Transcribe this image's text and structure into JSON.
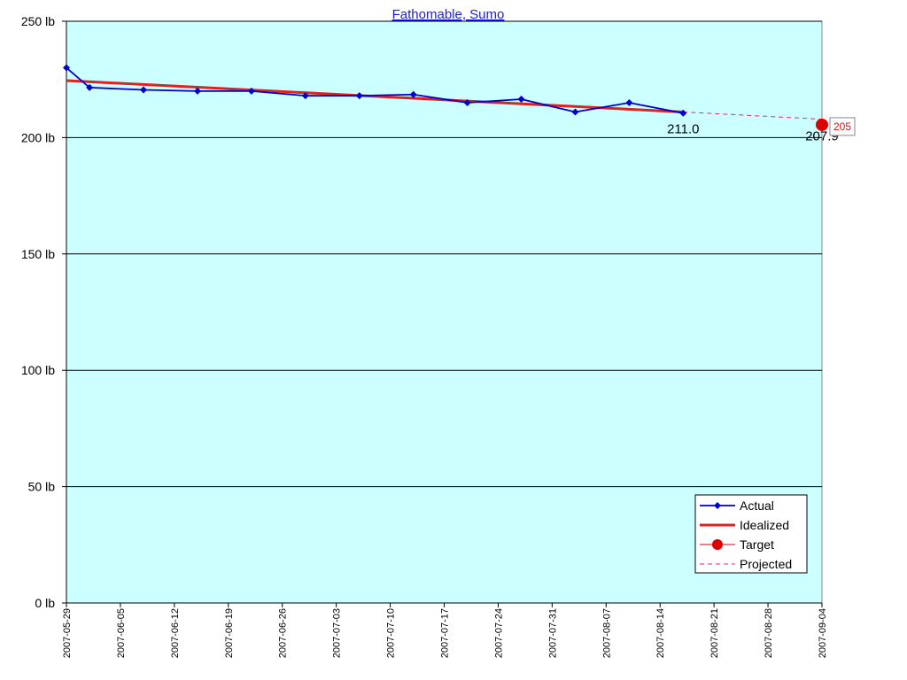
{
  "chart_data": {
    "type": "line",
    "title": "Fathomable, Sumo",
    "y_unit": "lb",
    "ylim": [
      0,
      250
    ],
    "y_ticks": [
      0,
      50,
      100,
      150,
      200,
      250
    ],
    "y_tick_labels": [
      "0 lb",
      "50 lb",
      "100 lb",
      "150 lb",
      "200 lb",
      "250 lb"
    ],
    "xlim": [
      "2007-05-29",
      "2007-09-04"
    ],
    "x_tick_labels": [
      "2007-05-29",
      "2007-06-05",
      "2007-06-12",
      "2007-06-19",
      "2007-06-26",
      "2007-07-03",
      "2007-07-10",
      "2007-07-17",
      "2007-07-24",
      "2007-07-31",
      "2007-08-07",
      "2007-08-14",
      "2007-08-21",
      "2007-08-28",
      "2007-09-04"
    ],
    "grid": "horizontal",
    "background": "#ccffff",
    "legend_position": "bottom-right",
    "series": [
      {
        "name": "Actual",
        "color": "#0000cc",
        "marker": "diamond",
        "x": [
          "2007-05-29",
          "2007-06-01",
          "2007-06-08",
          "2007-06-15",
          "2007-06-22",
          "2007-06-29",
          "2007-07-06",
          "2007-07-13",
          "2007-07-20",
          "2007-07-27",
          "2007-08-03",
          "2007-08-10",
          "2007-08-17"
        ],
        "values": [
          230.0,
          221.5,
          220.5,
          220.0,
          220.0,
          218.0,
          218.0,
          218.5,
          215.0,
          216.5,
          211.0,
          215.0,
          210.5
        ]
      },
      {
        "name": "Idealized",
        "color": "#dd2222",
        "x": [
          "2007-05-29",
          "2007-08-17"
        ],
        "values": [
          224.5,
          211.0
        ]
      },
      {
        "name": "Target",
        "color": "#dd0000",
        "marker": "circle",
        "x": [
          "2007-09-04"
        ],
        "values": [
          205.5
        ]
      },
      {
        "name": "Projected",
        "color": "#ee2277",
        "dashed": true,
        "x": [
          "2007-08-17",
          "2007-09-04"
        ],
        "values": [
          211.0,
          207.9
        ]
      }
    ],
    "annotations": [
      {
        "text": "211.0",
        "x": "2007-08-17",
        "y": 211.0,
        "color": "#000000"
      },
      {
        "text": "207.9",
        "x": "2007-09-04",
        "y": 207.9,
        "color": "#000000"
      },
      {
        "text": "205",
        "x": "2007-09-04",
        "y": 205.5,
        "color": "#dd1111",
        "boxed": true
      }
    ]
  }
}
